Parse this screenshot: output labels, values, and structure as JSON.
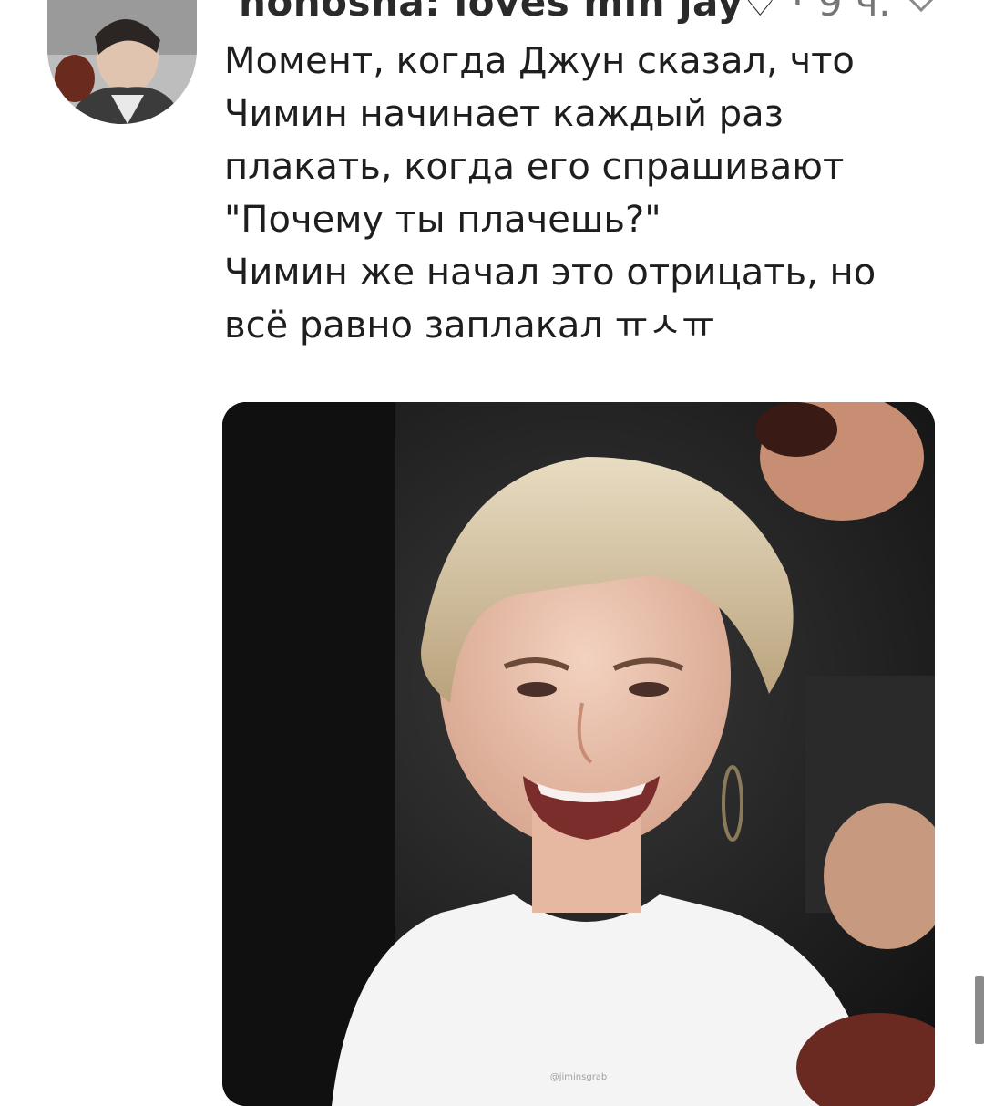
{
  "post": {
    "author": "nonosha: loves min jay",
    "author_badge": "♡",
    "separator": "·",
    "time_ago": "9 ч.",
    "text_lines": [
      "Момент, когда Джун сказал, что",
      "Чимин начинает каждый раз",
      "плакать, когда его спрашивают",
      "\"Почему ты плачешь?\"",
      "Чимин же начал это отрицать, но",
      "всё равно заплакал ㅠㅅㅠ"
    ]
  },
  "media": {
    "watermark": "@jiminsgrab"
  },
  "icons": {
    "menu": "chevron-down-icon",
    "avatar": "avatar-photo"
  },
  "colors": {
    "text": "#1e1e1e",
    "muted": "#777777",
    "background": "#ffffff"
  }
}
